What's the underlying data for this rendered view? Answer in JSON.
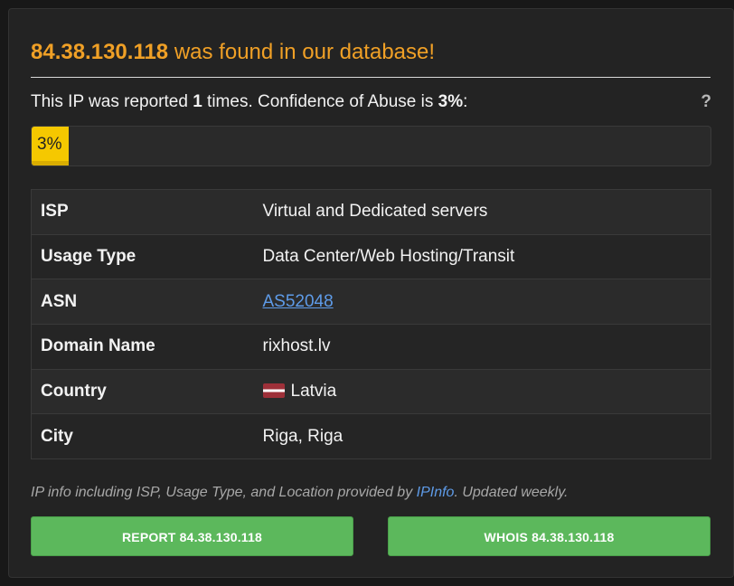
{
  "heading": {
    "ip": "84.38.130.118",
    "suffix": " was found in our database!"
  },
  "report": {
    "prefix": "This IP was reported ",
    "count": "1",
    "middle": " times. Confidence of Abuse is ",
    "confidence": "3%",
    "suffix": ":",
    "help_label": "?"
  },
  "progress": {
    "fraction": 0.03,
    "label": "3%",
    "color": "#f5c800"
  },
  "details": [
    {
      "key": "ISP",
      "value": "Virtual and Dedicated servers"
    },
    {
      "key": "Usage Type",
      "value": "Data Center/Web Hosting/Transit"
    },
    {
      "key": "ASN",
      "value": "AS52048",
      "link": true
    },
    {
      "key": "Domain Name",
      "value": "rixhost.lv"
    },
    {
      "key": "Country",
      "value": "Latvia",
      "flag": "latvia-flag-icon"
    },
    {
      "key": "City",
      "value": "Riga, Riga"
    }
  ],
  "footnote": {
    "prefix": "IP info including ISP, Usage Type, and Location provided by ",
    "link_text": "IPInfo",
    "suffix": ". Updated weekly."
  },
  "buttons": {
    "report_label": "REPORT 84.38.130.118",
    "whois_label": "WHOIS 84.38.130.118"
  },
  "colors": {
    "heading": "#f0a026",
    "link": "#5e9be8",
    "button": "#5cb85c"
  }
}
